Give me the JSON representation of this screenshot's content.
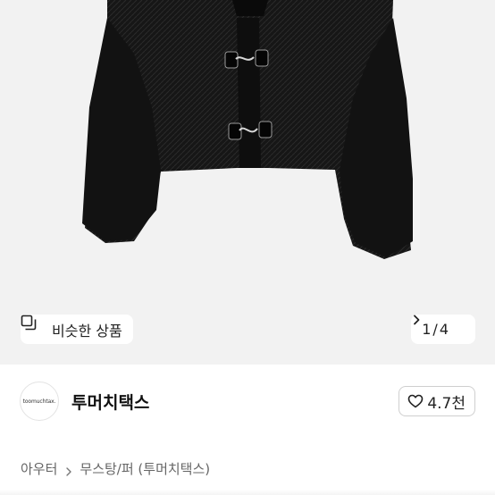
{
  "product_image": {
    "icon": "black-fur-jacket-image"
  },
  "similar_chip": {
    "icon": "similar-items-icon",
    "label": "비슷한 상품"
  },
  "image_counter": {
    "current": "1",
    "separator": "/",
    "total": "4",
    "icon": "chevron-right-icon"
  },
  "shop": {
    "logo_text": "toomuchtax.",
    "name": "투머치택스",
    "like_icon": "heart-outline-icon",
    "like_count": "4.7천"
  },
  "breadcrumb": {
    "items": [
      "아우터",
      "무스탕/퍼 (투머치택스)"
    ],
    "separator_icon": "chevron-right-icon"
  },
  "colors": {
    "image_background": "#f2f2f2",
    "jacket": "#141414",
    "text_primary": "#111111",
    "text_secondary": "#666666"
  }
}
